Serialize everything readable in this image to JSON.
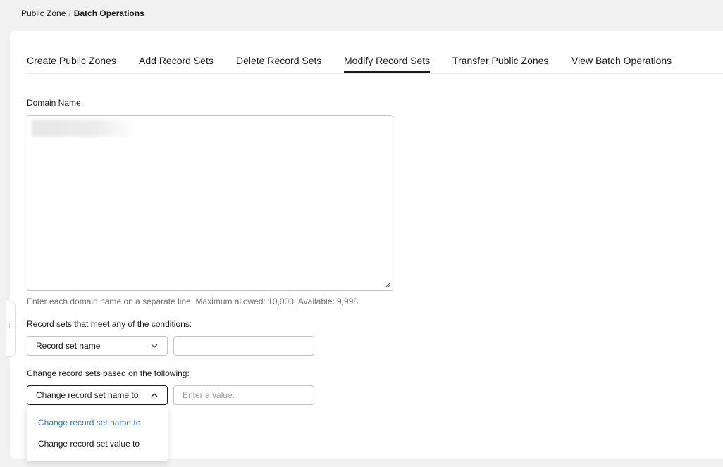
{
  "breadcrumb": {
    "parent": "Public Zone",
    "separator": "/",
    "current": "Batch Operations"
  },
  "tabs": [
    {
      "label": "Create Public Zones"
    },
    {
      "label": "Add Record Sets"
    },
    {
      "label": "Delete Record Sets"
    },
    {
      "label": "Modify Record Sets",
      "active": true
    },
    {
      "label": "Transfer Public Zones"
    },
    {
      "label": "View Batch Operations"
    }
  ],
  "domain": {
    "label": "Domain Name",
    "hint": "Enter each domain name on a separate line. Maximum allowed: 10,000; Available: 9,998."
  },
  "conditions": {
    "label": "Record sets that meet any of the conditions:",
    "select_value": "Record set name",
    "input_value": ""
  },
  "change": {
    "label": "Change record sets based on the following:",
    "select_value": "Change record set name to",
    "input_placeholder": "Enter a value.",
    "options": [
      {
        "label": "Change record set name to",
        "selected": true
      },
      {
        "label": "Change record set value to"
      }
    ]
  },
  "colors": {
    "accent": "#2e74d6",
    "text": "#191919",
    "muted": "#737373",
    "border": "#c2c2c2"
  }
}
